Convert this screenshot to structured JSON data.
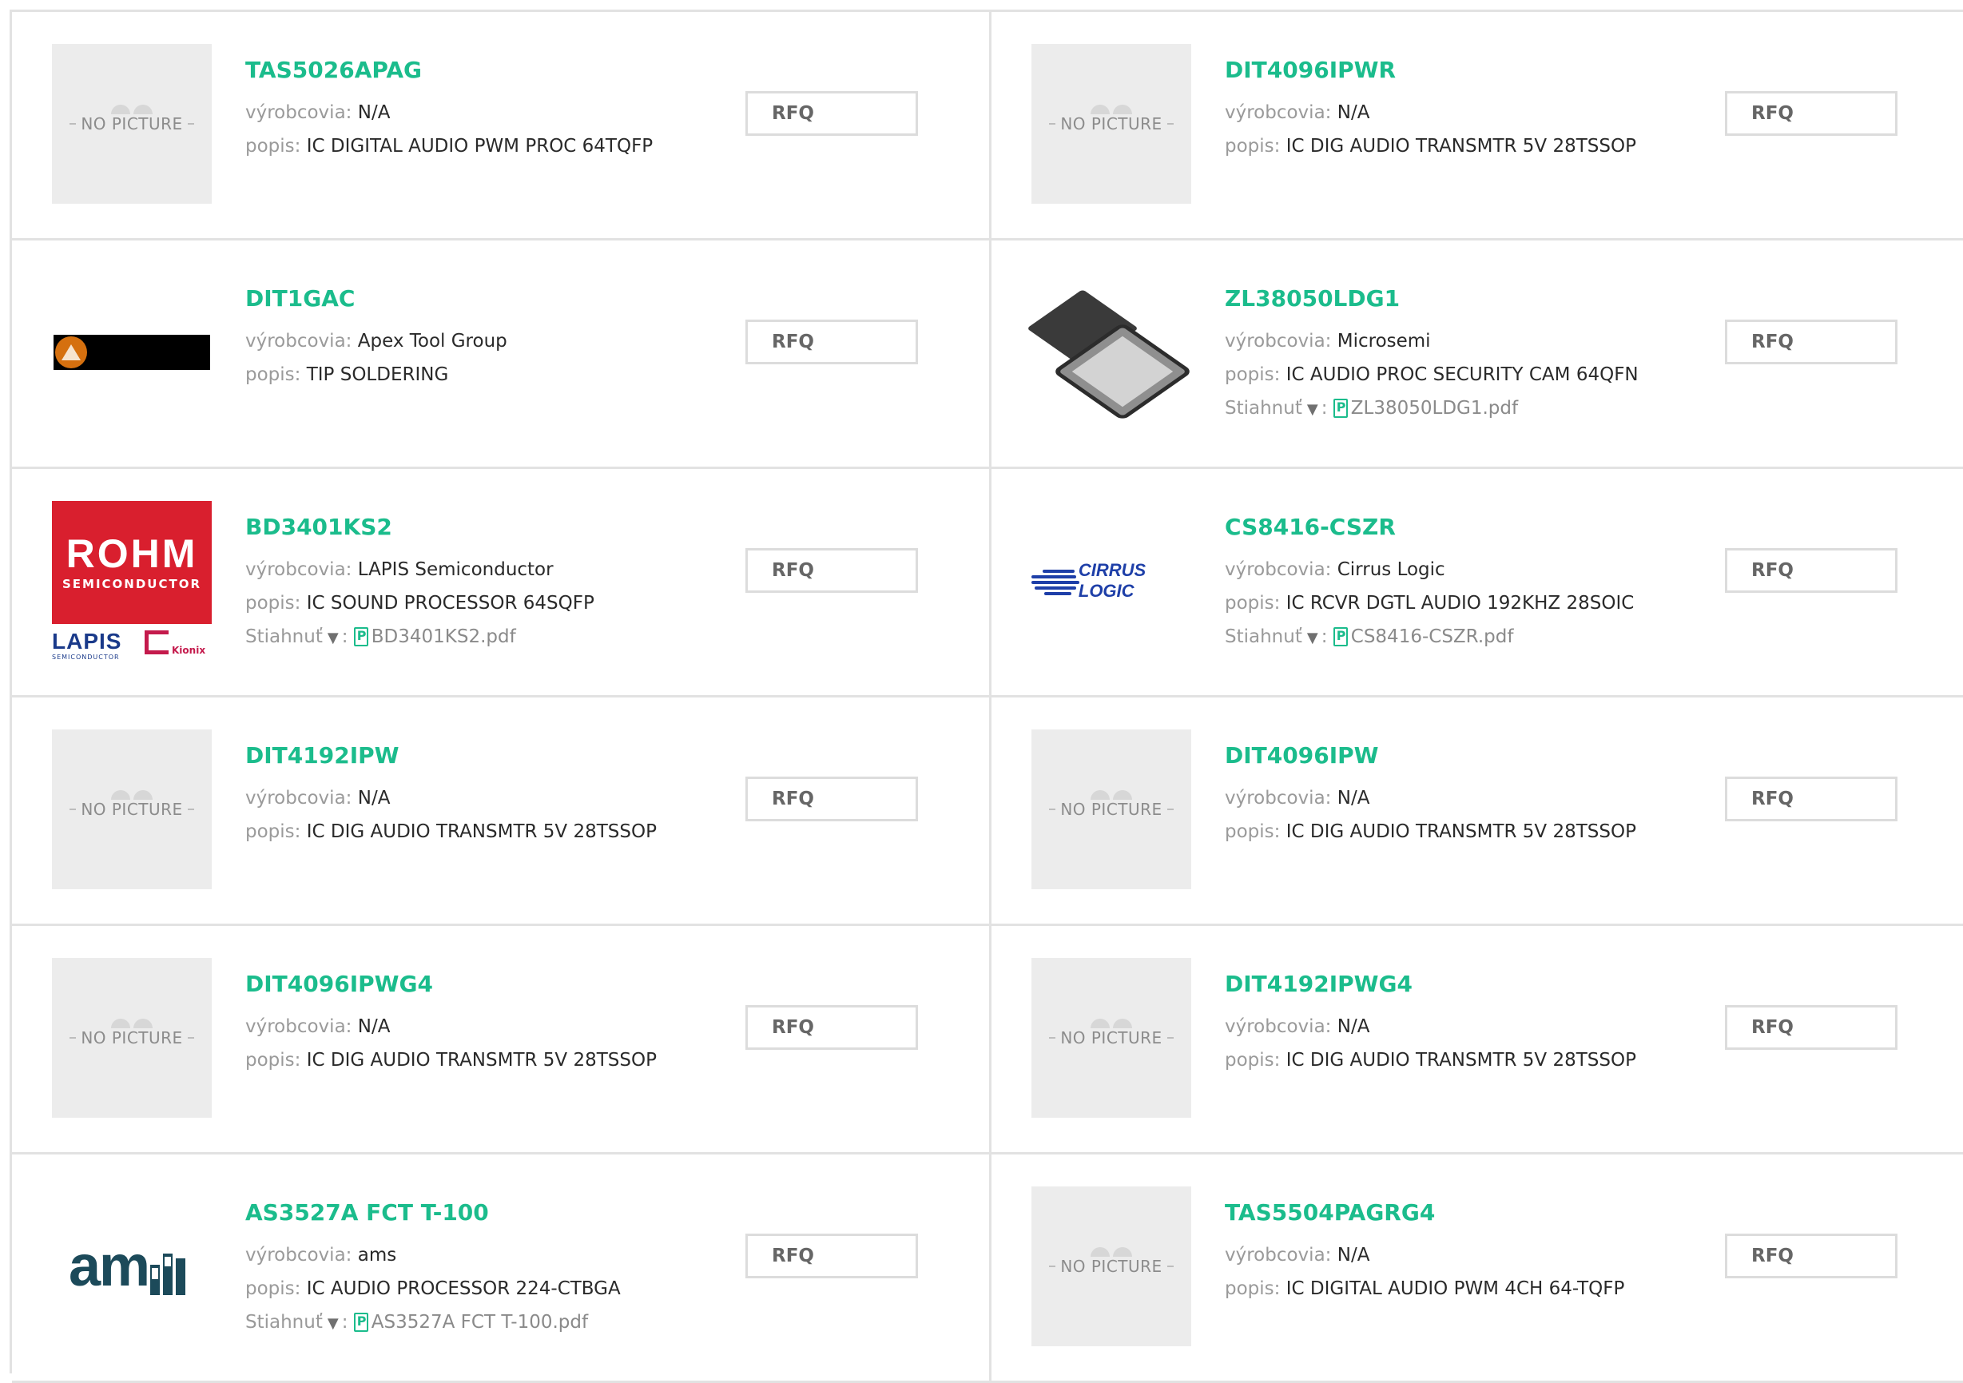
{
  "labels": {
    "manufacturer": "výrobcovia:",
    "description": "popis:",
    "download": "Stiahnuť",
    "download_caret": "▼",
    "rfq": "RFQ",
    "no_picture": "NO PICTURE"
  },
  "brand_color": "#1bbc8c",
  "products": [
    {
      "title": "TAS5026APAG",
      "manufacturer": "N/A",
      "description": "IC DIGITAL AUDIO PWM PROC 64TQFP",
      "image": "no-picture",
      "pdf": null
    },
    {
      "title": "DIT4096IPWR",
      "manufacturer": "N/A",
      "description": "IC DIG AUDIO TRANSMTR 5V 28TSSOP",
      "image": "no-picture",
      "pdf": null
    },
    {
      "title": "DIT1GAC",
      "manufacturer": "Apex Tool Group",
      "description": "TIP SOLDERING",
      "image": "apex-logo",
      "pdf": null
    },
    {
      "title": "ZL38050LDG1",
      "manufacturer": "Microsemi",
      "description": "IC AUDIO PROC SECURITY CAM 64QFN",
      "image": "qfn-chip-photo",
      "pdf": "ZL38050LDG1.pdf"
    },
    {
      "title": "BD3401KS2",
      "manufacturer": "LAPIS Semiconductor",
      "description": "IC SOUND PROCESSOR 64SQFP",
      "image": "rohm-lapis-logo",
      "pdf": "BD3401KS2.pdf"
    },
    {
      "title": "CS8416-CSZR",
      "manufacturer": "Cirrus Logic",
      "description": "IC RCVR DGTL AUDIO 192KHZ 28SOIC",
      "image": "cirrus-logic-logo",
      "pdf": "CS8416-CSZR.pdf"
    },
    {
      "title": "DIT4192IPW",
      "manufacturer": "N/A",
      "description": "IC DIG AUDIO TRANSMTR 5V 28TSSOP",
      "image": "no-picture",
      "pdf": null
    },
    {
      "title": "DIT4096IPW",
      "manufacturer": "N/A",
      "description": "IC DIG AUDIO TRANSMTR 5V 28TSSOP",
      "image": "no-picture",
      "pdf": null
    },
    {
      "title": "DIT4096IPWG4",
      "manufacturer": "N/A",
      "description": "IC DIG AUDIO TRANSMTR 5V 28TSSOP",
      "image": "no-picture",
      "pdf": null
    },
    {
      "title": "DIT4192IPWG4",
      "manufacturer": "N/A",
      "description": "IC DIG AUDIO TRANSMTR 5V 28TSSOP",
      "image": "no-picture",
      "pdf": null
    },
    {
      "title": "AS3527A FCT T-100",
      "manufacturer": "ams",
      "description": "IC AUDIO PROCESSOR 224-CTBGA",
      "image": "ams-logo",
      "pdf": "AS3527A FCT T-100.pdf"
    },
    {
      "title": "TAS5504PAGRG4",
      "manufacturer": "N/A",
      "description": "IC DIGITAL AUDIO PWM 4CH 64-TQFP",
      "image": "no-picture",
      "pdf": null
    }
  ],
  "logo_text": {
    "rohm": "ROHM",
    "rohm_sub": "SEMICONDUCTOR",
    "lapis": "LAPIS",
    "lapis_sub": "SEMICONDUCTOR",
    "kionix": "Kionix",
    "cirrus": "CIRRUS LOGIC",
    "ams": "am"
  }
}
